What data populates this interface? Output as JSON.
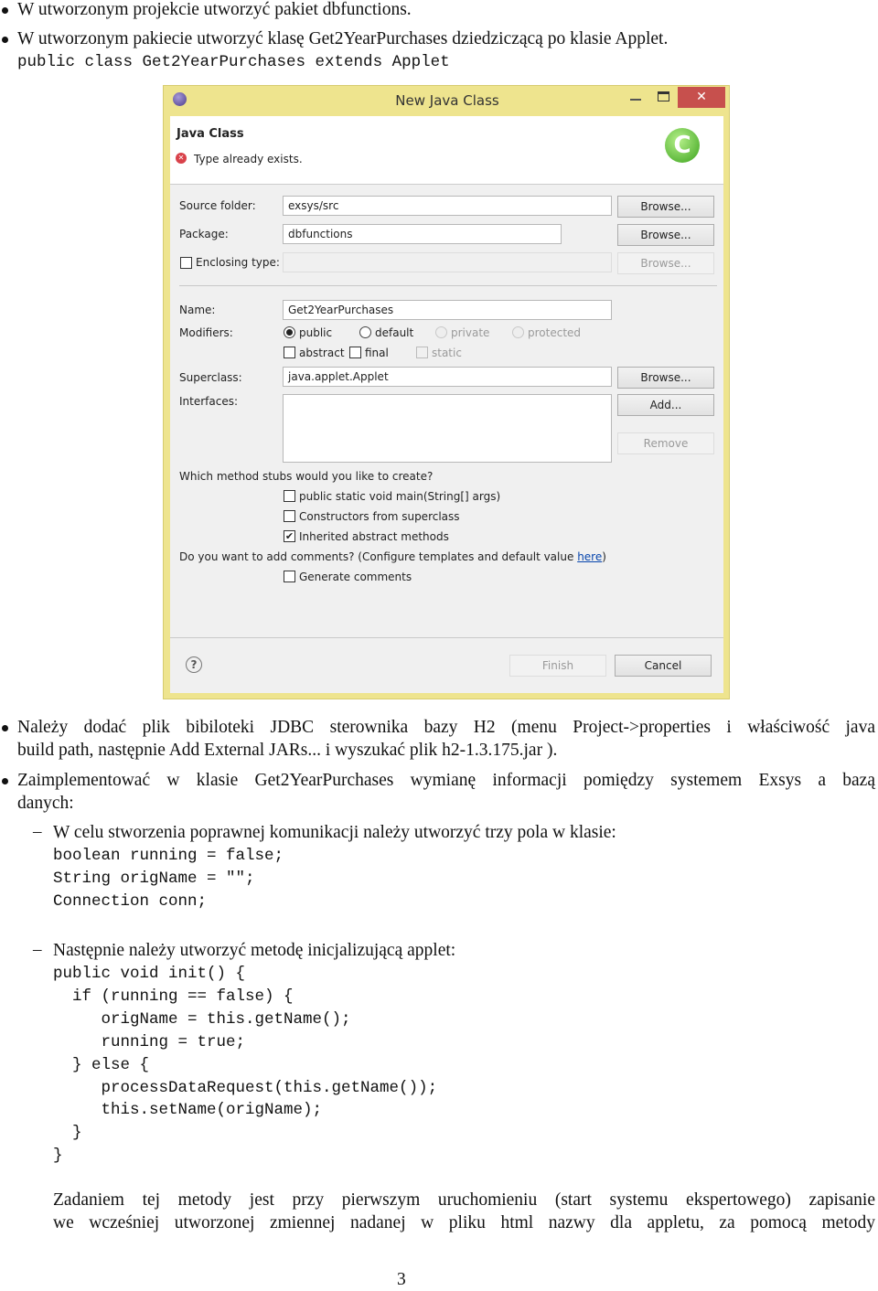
{
  "doc": {
    "bullet1": "W utworzonym projekcie utworzyć pakiet dbfunctions.",
    "bullet2": "W utworzonym pakiecie utworzyć klasę Get2YearPurchases dziedziczącą po klasie Applet.",
    "code1": "public class Get2YearPurchases extends Applet",
    "bullet3": [
      "Należy dodać plik bibiloteki JDBC sterownika bazy H2 (menu Project->properties i właściwość java",
      "build path, następnie Add External JARs... i wyszukać plik h2-1.3.175.jar )."
    ],
    "bullet4": [
      "Zaimplementować w klasie Get2YearPurchases wymianę informacji pomiędzy systemem Exsys a bazą",
      "danych:"
    ],
    "sub1": "W celu stworzenia poprawnej komunikacji należy utworzyć trzy pola w klasie:",
    "code2": [
      "boolean running = false;",
      "String origName = \"\";",
      "Connection conn;"
    ],
    "sub2": "Następnie należy utworzyć metodę inicjalizującą applet:",
    "code3": [
      "public void init() {",
      "  if (running == false) {",
      "     origName = this.getName();",
      "     running = true;",
      "  } else {",
      "     processDataRequest(this.getName());",
      "     this.setName(origName);",
      "  }",
      "}"
    ],
    "para": [
      "Zadaniem tej metody jest przy pierwszym uruchomieniu (start systemu ekspertowego) zapisanie",
      "we wcześniej utworzonej zmiennej nadanej w pliku html nazwy dla appletu, za pomocą metody"
    ],
    "page_number": "3"
  },
  "dialog": {
    "title": "New Java Class",
    "header_title": "Java Class",
    "error": "Type already exists.",
    "source_folder_label": "Source folder:",
    "source_folder": "exsys/src",
    "package_label": "Package:",
    "package": "dbfunctions",
    "enclosing_label": "Enclosing type:",
    "enclosing": "",
    "browse": "Browse...",
    "name_label": "Name:",
    "name": "Get2YearPurchases",
    "modifiers_label": "Modifiers:",
    "mod_public": "public",
    "mod_default": "default",
    "mod_private": "private",
    "mod_protected": "protected",
    "mod_abstract": "abstract",
    "mod_final": "final",
    "mod_static": "static",
    "superclass_label": "Superclass:",
    "superclass": "java.applet.Applet",
    "interfaces_label": "Interfaces:",
    "add": "Add...",
    "remove": "Remove",
    "stubs_q": "Which method stubs would you like to create?",
    "stub_main": "public static void main(String[] args)",
    "stub_ctor": "Constructors from superclass",
    "stub_inherited": "Inherited abstract methods",
    "comments_q": "Do you want to add comments? (Configure templates and default value ",
    "here": "here",
    "comments_close": ")",
    "gen_comments": "Generate comments",
    "finish": "Finish",
    "cancel": "Cancel",
    "colors": {
      "frame": "#eee48e",
      "close": "#c7504d",
      "link": "#0645ad"
    }
  }
}
